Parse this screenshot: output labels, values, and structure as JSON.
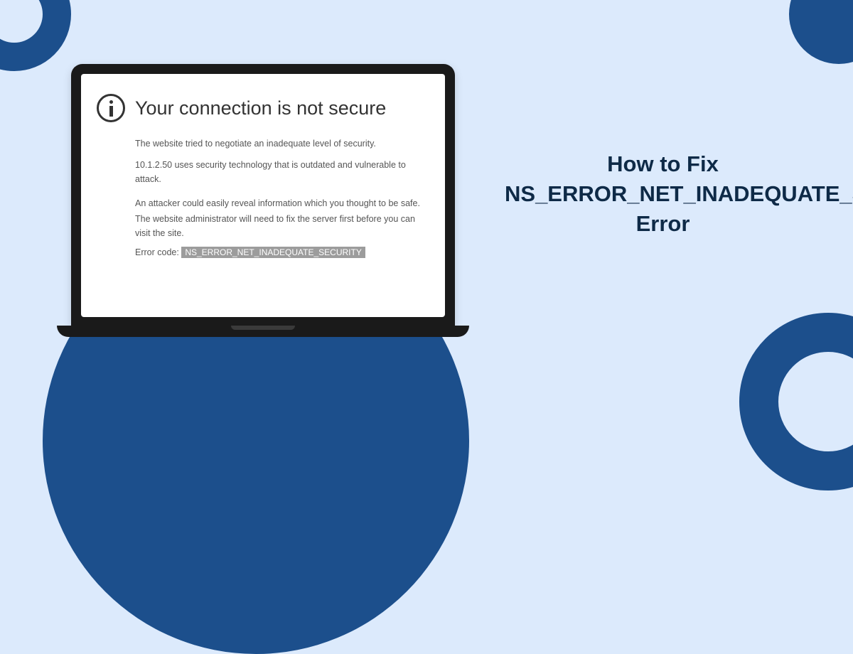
{
  "colors": {
    "bg": "#dceafc",
    "accent": "#1c4f8c",
    "headline": "#0e2a47"
  },
  "screen": {
    "title": "Your connection is not secure",
    "line1": "The website tried to negotiate an inadequate level of security.",
    "line2": "10.1.2.50 uses security technology that is outdated and vulnerable to attack.",
    "line3": "An attacker could easily reveal information which you thought to be safe.",
    "line4": "The website administrator will need to fix the server first before you can visit the site.",
    "error_code_label": "Error code:",
    "error_code_value": "NS_ERROR_NET_INADEQUATE_SECURITY"
  },
  "headline": {
    "text": "How to Fix NS_ERROR_NET_INADEQUATE_SECURITY Error"
  }
}
